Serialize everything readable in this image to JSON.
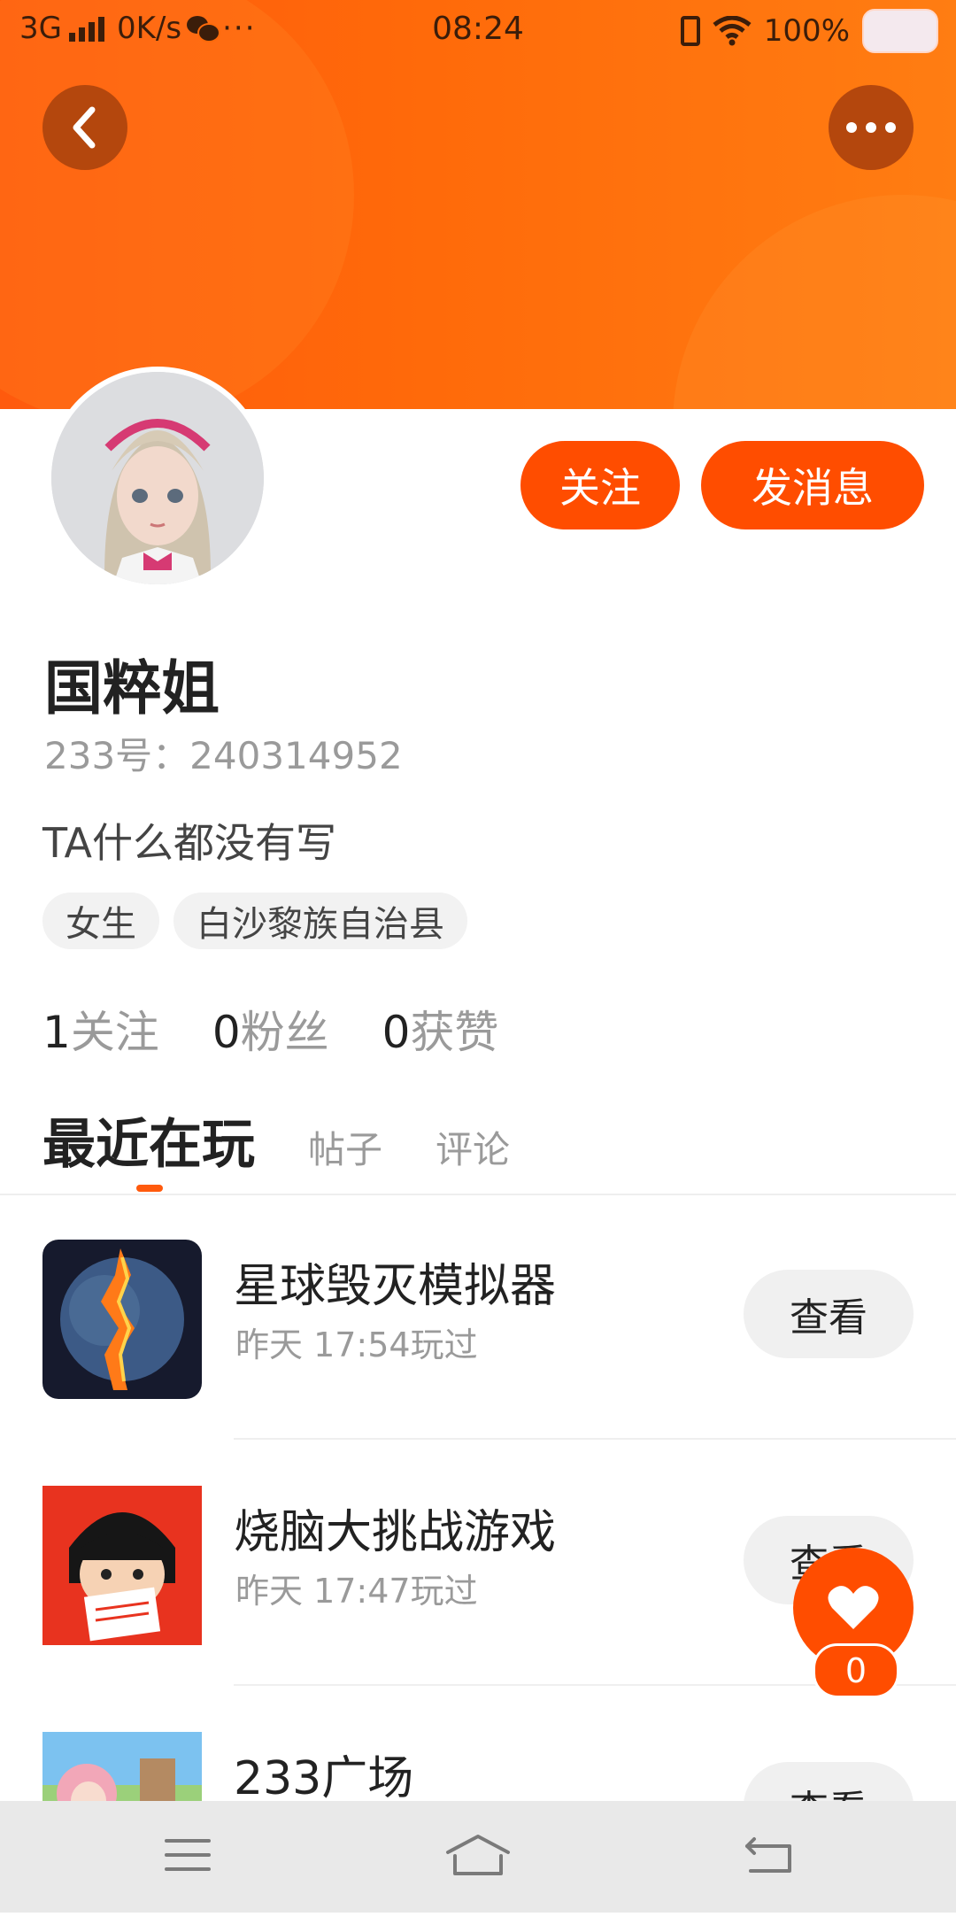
{
  "status_bar": {
    "network": "3G",
    "speed": "0K/s",
    "more": "···",
    "time": "08:24",
    "battery": "100%"
  },
  "profile": {
    "name": "国粹姐",
    "id_line": "233号：240314952",
    "bio": "TA什么都没有写",
    "tags": [
      "女生",
      "白沙黎族自治县"
    ],
    "stats": [
      {
        "num": "1",
        "label": "关注"
      },
      {
        "num": "0",
        "label": "粉丝"
      },
      {
        "num": "0",
        "label": "获赞"
      }
    ]
  },
  "actions": {
    "follow_label": "关注",
    "message_label": "发消息"
  },
  "tabs": [
    "最近在玩",
    "帖子",
    "评论"
  ],
  "games": [
    {
      "title": "星球毁灭模拟器",
      "time": "昨天 17:54玩过",
      "button": "查看",
      "icon": "planet-icon"
    },
    {
      "title": "烧脑大挑战游戏",
      "time": "昨天 17:47玩过",
      "button": "查看",
      "icon": "cartoon-girl-icon"
    },
    {
      "title": "233广场",
      "time": "",
      "button": "查看",
      "icon": "anime-square-icon"
    }
  ],
  "like": {
    "count": "0"
  },
  "colors": {
    "brand": "#ff4d00",
    "banner_start": "#ff5a0d",
    "banner_end": "#ff7d12"
  }
}
